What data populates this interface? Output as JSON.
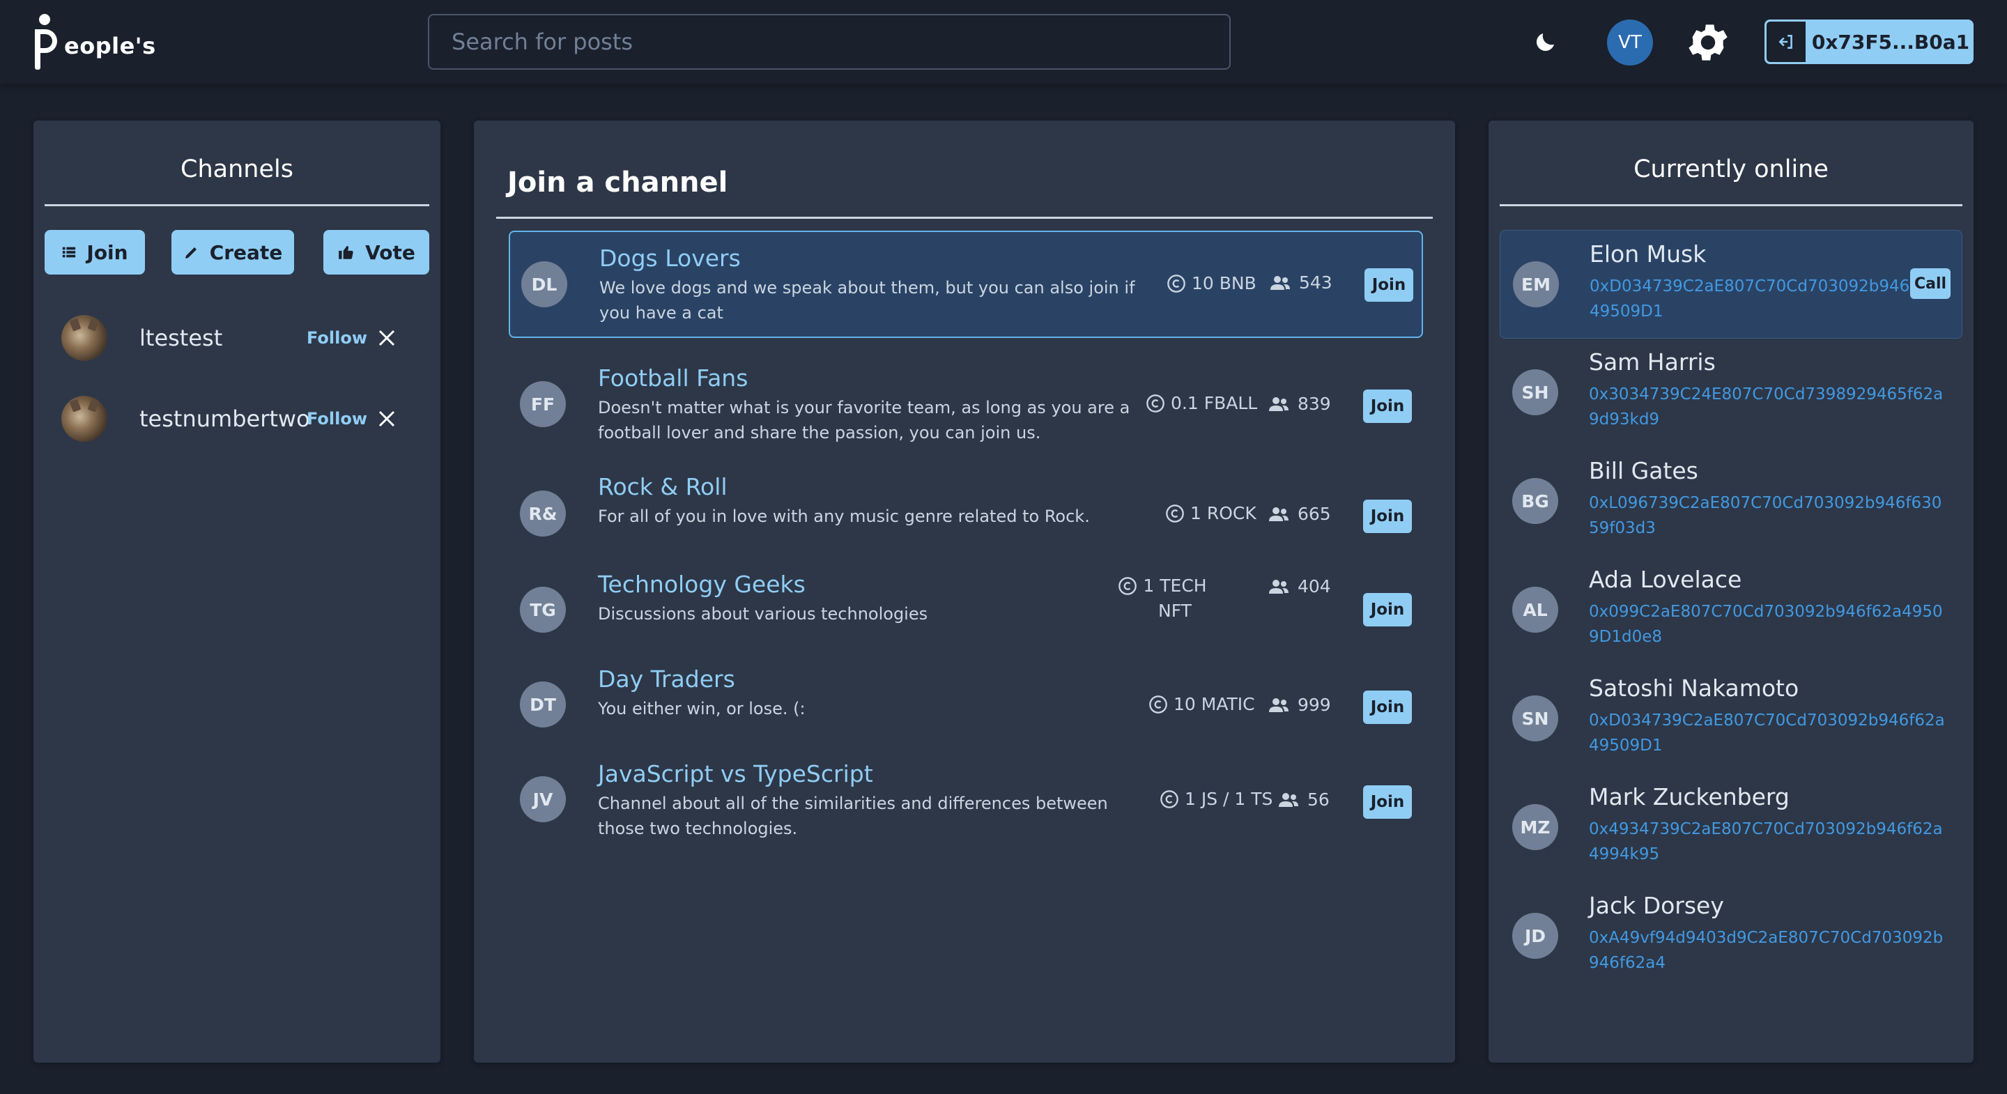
{
  "header": {
    "logo_text": "eople's",
    "search_placeholder": "Search for posts",
    "user_initials": "VT",
    "wallet_address": "0x73F5...B0a1"
  },
  "left": {
    "title": "Channels",
    "buttons": {
      "join": "Join",
      "create": "Create",
      "vote": "Vote"
    },
    "users": [
      {
        "name": "ltestest",
        "follow": "Follow"
      },
      {
        "name": "testnumbertwo",
        "follow": "Follow"
      }
    ]
  },
  "middle": {
    "title": "Join a channel",
    "join_label": "Join",
    "channels": [
      {
        "initials": "DL",
        "name": "Dogs Lovers",
        "desc": "We love dogs and we speak about them, but you can also join if you have a cat",
        "price": "10 BNB",
        "members": "543"
      },
      {
        "initials": "FF",
        "name": "Football Fans",
        "desc": "Doesn't matter what is your favorite team, as long as you are a football lover and share the passion, you can join us.",
        "price": "0.1 FBALL",
        "members": "839"
      },
      {
        "initials": "R&",
        "name": "Rock & Roll",
        "desc": "For all of you in love with any music genre related to Rock.",
        "price": "1 ROCK",
        "members": "665"
      },
      {
        "initials": "TG",
        "name": "Technology Geeks",
        "desc": "Discussions about various technologies",
        "price": "1 TECH NFT",
        "members": "404"
      },
      {
        "initials": "DT",
        "name": "Day Traders",
        "desc": "You either win, or lose. (:",
        "price": "10 MATIC",
        "members": "999"
      },
      {
        "initials": "JV",
        "name": "JavaScript vs TypeScript",
        "desc": "Channel about all of the similarities and differences between those two technologies.",
        "price": "1 JS / 1 TS",
        "members": "56"
      }
    ]
  },
  "right": {
    "title": "Currently online",
    "call_label": "Call",
    "users": [
      {
        "initials": "EM",
        "name": "Elon Musk",
        "address": "0xD034739C2aE807C70Cd703092b946f62a49509D1"
      },
      {
        "initials": "SH",
        "name": "Sam Harris",
        "address": "0x3034739C24E807C70Cd7398929465f62a9d93kd9"
      },
      {
        "initials": "BG",
        "name": "Bill Gates",
        "address": "0xL096739C2aE807C70Cd703092b946f63059f03d3"
      },
      {
        "initials": "AL",
        "name": "Ada Lovelace",
        "address": "0x099C2aE807C70Cd703092b946f62a49509D1d0e8"
      },
      {
        "initials": "SN",
        "name": "Satoshi Nakamoto",
        "address": "0xD034739C2aE807C70Cd703092b946f62a49509D1"
      },
      {
        "initials": "MZ",
        "name": "Mark Zuckenberg",
        "address": "0x4934739C2aE807C70Cd703092b946f62a4994k95"
      },
      {
        "initials": "JD",
        "name": "Jack Dorsey",
        "address": "0xA49vf94d9403d9C2aE807C70Cd703092b946f62a4"
      }
    ]
  },
  "colors": {
    "accent": "#90cdf4",
    "link": "#4299e1",
    "panel": "#2d3748",
    "background": "#1a202c",
    "active_row": "#2a4365"
  },
  "icons": [
    "moon-icon",
    "gear-icon",
    "logout-icon",
    "list-icon",
    "pencil-icon",
    "thumbs-up-icon",
    "close-icon",
    "coin-icon",
    "users-icon"
  ]
}
